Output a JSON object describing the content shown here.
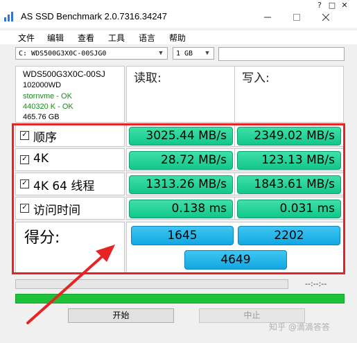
{
  "window": {
    "title": "AS SSD Benchmark 2.0.7316.34247",
    "mini_controls": [
      "?",
      "□",
      "✕"
    ]
  },
  "menu": [
    "文件",
    "编辑",
    "查看",
    "工具",
    "语言",
    "帮助"
  ],
  "toolbar": {
    "drive": "C: WDS500G3X0C-00SJG0",
    "size": "1 GB"
  },
  "info": {
    "model": "WDS500G3X0C-00SJ",
    "firmware": "102000WD",
    "driver": "stornvme - OK",
    "alignment": "440320 K - OK",
    "capacity": "465.76 GB"
  },
  "columns": {
    "read": "读取:",
    "write": "写入:"
  },
  "rows": [
    {
      "label": "顺序",
      "read": "3025.44 MB/s",
      "write": "2349.02 MB/s"
    },
    {
      "label": "4K",
      "read": "28.72 MB/s",
      "write": "123.13 MB/s"
    },
    {
      "label": "4K 64 线程",
      "read": "1313.26 MB/s",
      "write": "1843.61 MB/s"
    },
    {
      "label": "访问时间",
      "read": "0.138 ms",
      "write": "0.031 ms"
    }
  ],
  "score": {
    "label": "得分:",
    "read": "1645",
    "write": "2202",
    "total": "4649"
  },
  "timer": "--:--:--",
  "buttons": {
    "start": "开始",
    "stop": "中止"
  },
  "watermark": "知乎 @滴滴答答",
  "colors": {
    "result_green": "#1ccb8e",
    "score_blue": "#25b3ea",
    "highlight_red": "#e62424",
    "progress_green": "#1ec13a"
  }
}
